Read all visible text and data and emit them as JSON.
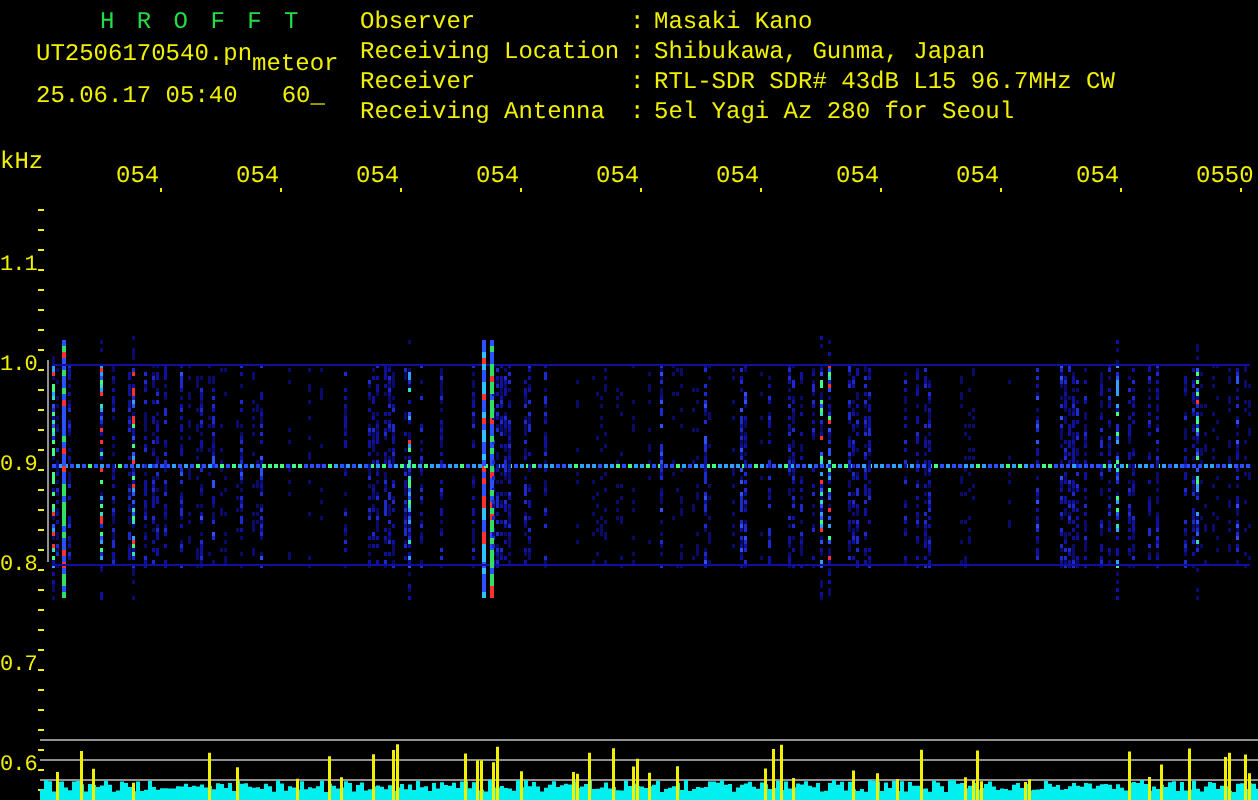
{
  "app": {
    "title": "H R O F F T"
  },
  "file": {
    "name": "UT2506170540.pn",
    "tag": "meteor",
    "datetime": "25.06.17 05:40",
    "interval": "60_"
  },
  "info": [
    {
      "label": "Observer",
      "separator": ":",
      "value": "Masaki Kano"
    },
    {
      "label": "Receiving Location",
      "separator": ":",
      "value": "Shibukawa, Gunma, Japan"
    },
    {
      "label": "Receiver",
      "separator": ":",
      "value": "RTL-SDR SDR# 43dB L15 96.7MHz CW"
    },
    {
      "label": "Receiving Antenna",
      "separator": ":",
      "value": "5el Yagi Az 280 for Seoul"
    }
  ],
  "spectrogram": {
    "unit": "kHz",
    "time_labels": [
      "054",
      "054",
      "054",
      "054",
      "054",
      "054",
      "054",
      "054",
      "054",
      "0550"
    ],
    "freq_labels": [
      "1.1",
      "1.0",
      "0.9",
      "0.8",
      "0.7",
      "0.6"
    ]
  }
}
